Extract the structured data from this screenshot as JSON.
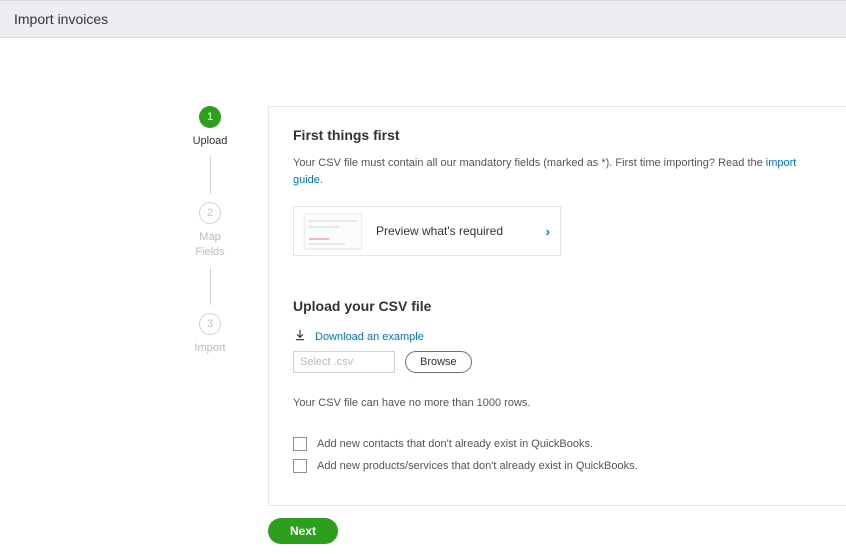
{
  "header": {
    "title": "Import invoices"
  },
  "stepper": {
    "steps": [
      {
        "num": "1",
        "label": "Upload"
      },
      {
        "num": "2",
        "label": "Map\nFields"
      },
      {
        "num": "3",
        "label": "Import"
      }
    ]
  },
  "intro": {
    "title": "First things first",
    "text_before": "Your CSV file must contain all our mandatory fields (marked as *). First time importing? Read the ",
    "link": "import guide",
    "text_after": "."
  },
  "preview": {
    "label": "Preview what's required",
    "chevron": "›"
  },
  "upload": {
    "title": "Upload your CSV file",
    "download_link": "Download an example",
    "file_placeholder": "Select .csv",
    "browse_label": "Browse",
    "row_note": "Your CSV file can have no more than 1000 rows."
  },
  "options": {
    "add_contacts": "Add new contacts that don't already exist in QuickBooks.",
    "add_products": "Add new products/services that don't already exist in QuickBooks."
  },
  "footer": {
    "next_label": "Next"
  }
}
